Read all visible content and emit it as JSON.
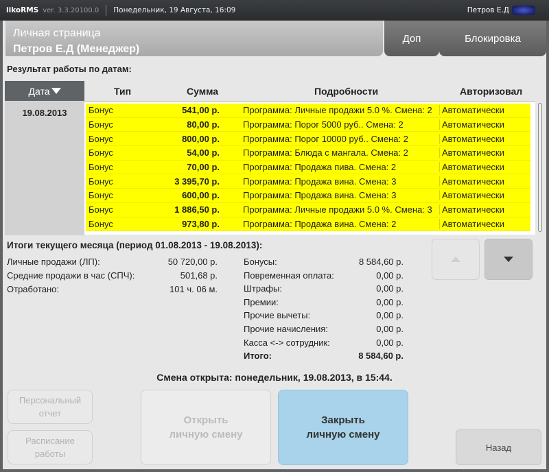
{
  "window": {
    "app_name": "iikoRMS",
    "version": "ver. 3.3.20100.0",
    "datetime": "Понедельник, 19 Августа, 16:09",
    "user": "Петров Е.Д"
  },
  "header": {
    "page_title": "Личная страница",
    "person": "Петров Е.Д (Менеджер)",
    "btn_extra": "Доп",
    "btn_lock": "Блокировка"
  },
  "results": {
    "title": "Результат работы по датам:",
    "columns": {
      "date": "Дата",
      "type": "Тип",
      "sum": "Сумма",
      "details": "Подробности",
      "authorized": "Авторизовал"
    },
    "date": "19.08.2013",
    "rows": [
      {
        "type": "Бонус",
        "sum": "541,00 р.",
        "details": "Программа: Личные продажи 5.0 %. Смена: 2",
        "auth": "Автоматически"
      },
      {
        "type": "Бонус",
        "sum": "80,00 р.",
        "details": "Программа: Порог 5000 руб.. Смена: 2",
        "auth": "Автоматически"
      },
      {
        "type": "Бонус",
        "sum": "800,00 р.",
        "details": "Программа: Порог 10000 руб.. Смена: 2",
        "auth": "Автоматически"
      },
      {
        "type": "Бонус",
        "sum": "54,00 р.",
        "details": "Программа: Блюда с мангала. Смена: 2",
        "auth": "Автоматически"
      },
      {
        "type": "Бонус",
        "sum": "70,00 р.",
        "details": "Программа: Продажа пива. Смена: 2",
        "auth": "Автоматически"
      },
      {
        "type": "Бонус",
        "sum": "3 395,70 р.",
        "details": "Программа: Продажа вина. Смена: 3",
        "auth": "Автоматически"
      },
      {
        "type": "Бонус",
        "sum": "600,00 р.",
        "details": "Программа: Продажа вина. Смена: 3",
        "auth": "Автоматически"
      },
      {
        "type": "Бонус",
        "sum": "1 886,50 р.",
        "details": "Программа: Личные продажи 5.0 %. Смена: 3",
        "auth": "Автоматически"
      },
      {
        "type": "Бонус",
        "sum": "973,80 р.",
        "details": "Программа: Продажа вина. Смена: 2",
        "auth": "Автоматически"
      }
    ],
    "row_color": "#ffff00"
  },
  "month": {
    "title": "Итоги текущего месяца (период 01.08.2013 - 19.08.2013):",
    "left": [
      {
        "label": "Личные продажи (ЛП):",
        "value": "50 720,00 р."
      },
      {
        "label": "Средние продажи в час (СПЧ):",
        "value": "501,68 р."
      },
      {
        "label": "Отработано:",
        "value": "101 ч. 06 м."
      }
    ],
    "right": [
      {
        "label": "Бонусы:",
        "value": "8 584,60 р."
      },
      {
        "label": "Повременная оплата:",
        "value": "0,00 р."
      },
      {
        "label": "Штрафы:",
        "value": "0,00 р."
      },
      {
        "label": "Премии:",
        "value": "0,00 р."
      },
      {
        "label": "Прочие вычеты:",
        "value": "0,00 р."
      },
      {
        "label": "Прочие начисления:",
        "value": "0,00 р."
      },
      {
        "label": "Касса <-> сотрудник:",
        "value": "0,00 р."
      },
      {
        "label": "Итого:",
        "value": "8 584,60 р."
      }
    ]
  },
  "shift_status": "Смена открыта: понедельник, 19.08.2013, в 15:44.",
  "buttons": {
    "personal_report_1": "Персональный",
    "personal_report_2": "отчет",
    "schedule_1": "Расписание",
    "schedule_2": "работы",
    "open_shift_1": "Открыть",
    "open_shift_2": "личную смену",
    "close_shift_1": "Закрыть",
    "close_shift_2": "личную смену",
    "back": "Назад"
  },
  "icons": {
    "sort": "sort-desc-icon",
    "scroll_up": "arrow-up-icon",
    "scroll_down": "arrow-down-icon"
  }
}
